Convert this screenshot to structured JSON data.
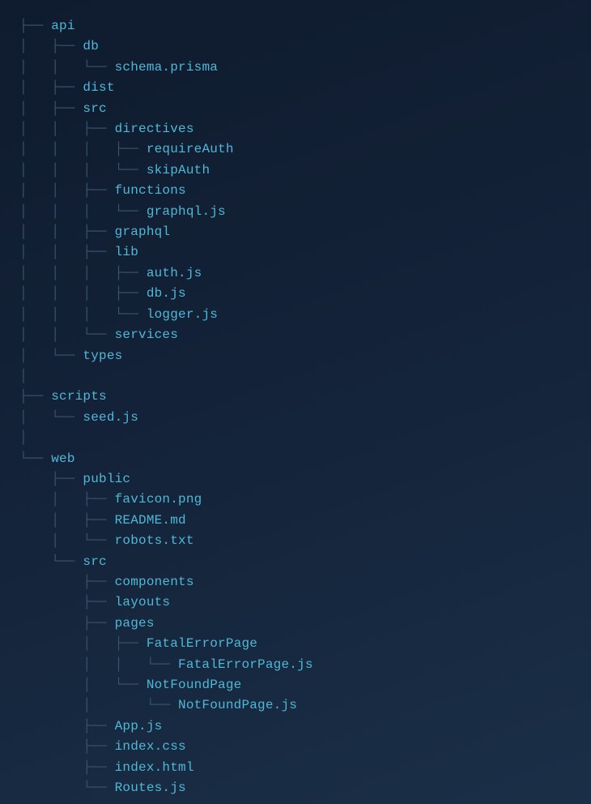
{
  "tree": [
    {
      "prefix": "├── ",
      "name": "api"
    },
    {
      "prefix": "│   ├── ",
      "name": "db"
    },
    {
      "prefix": "│   │   └── ",
      "name": "schema.prisma"
    },
    {
      "prefix": "│   ├── ",
      "name": "dist"
    },
    {
      "prefix": "│   ├── ",
      "name": "src"
    },
    {
      "prefix": "│   │   ├── ",
      "name": "directives"
    },
    {
      "prefix": "│   │   │   ├── ",
      "name": "requireAuth"
    },
    {
      "prefix": "│   │   │   └── ",
      "name": "skipAuth"
    },
    {
      "prefix": "│   │   ├── ",
      "name": "functions"
    },
    {
      "prefix": "│   │   │   └── ",
      "name": "graphql.js"
    },
    {
      "prefix": "│   │   ├── ",
      "name": "graphql"
    },
    {
      "prefix": "│   │   ├── ",
      "name": "lib"
    },
    {
      "prefix": "│   │   │   ├── ",
      "name": "auth.js"
    },
    {
      "prefix": "│   │   │   ├── ",
      "name": "db.js"
    },
    {
      "prefix": "│   │   │   └── ",
      "name": "logger.js"
    },
    {
      "prefix": "│   │   └── ",
      "name": "services"
    },
    {
      "prefix": "│   └── ",
      "name": "types"
    },
    {
      "prefix": "│",
      "name": ""
    },
    {
      "prefix": "├── ",
      "name": "scripts"
    },
    {
      "prefix": "│   └── ",
      "name": "seed.js"
    },
    {
      "prefix": "│",
      "name": ""
    },
    {
      "prefix": "└── ",
      "name": "web"
    },
    {
      "prefix": "    ├── ",
      "name": "public"
    },
    {
      "prefix": "    │   ├── ",
      "name": "favicon.png"
    },
    {
      "prefix": "    │   ├── ",
      "name": "README.md"
    },
    {
      "prefix": "    │   └── ",
      "name": "robots.txt"
    },
    {
      "prefix": "    └── ",
      "name": "src"
    },
    {
      "prefix": "        ├── ",
      "name": "components"
    },
    {
      "prefix": "        ├── ",
      "name": "layouts"
    },
    {
      "prefix": "        ├── ",
      "name": "pages"
    },
    {
      "prefix": "        │   ├── ",
      "name": "FatalErrorPage"
    },
    {
      "prefix": "        │   │   └── ",
      "name": "FatalErrorPage.js"
    },
    {
      "prefix": "        │   └── ",
      "name": "NotFoundPage"
    },
    {
      "prefix": "        │       └── ",
      "name": "NotFoundPage.js"
    },
    {
      "prefix": "        ├── ",
      "name": "App.js"
    },
    {
      "prefix": "        ├── ",
      "name": "index.css"
    },
    {
      "prefix": "        ├── ",
      "name": "index.html"
    },
    {
      "prefix": "        └── ",
      "name": "Routes.js"
    }
  ]
}
